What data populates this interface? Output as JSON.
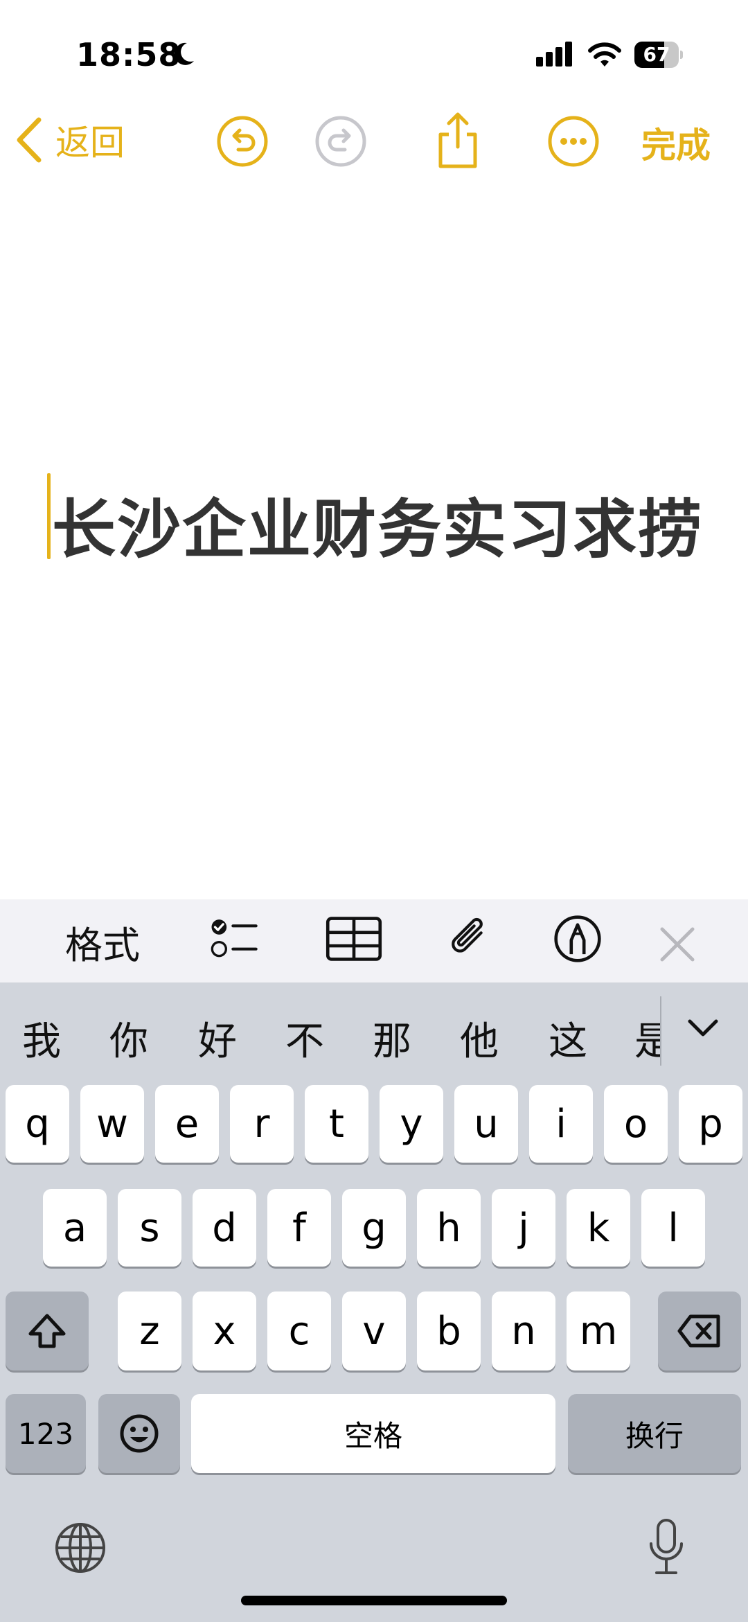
{
  "status_bar": {
    "time": "18:58",
    "battery": "67",
    "battery_level": 0.67
  },
  "nav": {
    "back_label": "返回",
    "done_label": "完成",
    "accent": "#E5B21A"
  },
  "note": {
    "title": "长沙企业财务实习求捞"
  },
  "toolbar": {
    "format_label": "格式"
  },
  "keyboard": {
    "candidates": [
      "我",
      "你",
      "好",
      "不",
      "那",
      "他",
      "这",
      "是"
    ],
    "row1": [
      "q",
      "w",
      "e",
      "r",
      "t",
      "y",
      "u",
      "i",
      "o",
      "p"
    ],
    "row2": [
      "a",
      "s",
      "d",
      "f",
      "g",
      "h",
      "j",
      "k",
      "l"
    ],
    "row3": [
      "z",
      "x",
      "c",
      "v",
      "b",
      "n",
      "m"
    ],
    "numbers_label": "123",
    "space_label": "空格",
    "return_label": "换行"
  }
}
